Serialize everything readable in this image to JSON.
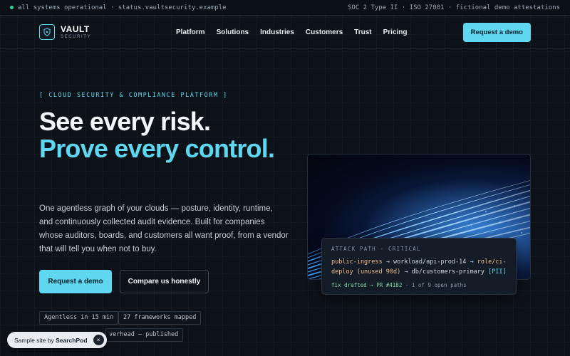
{
  "statusbar": {
    "left": "all systems operational · status.vaultsecurity.example",
    "right": "SOC 2 Type II · ISO 27001 · fictional demo attestations"
  },
  "brand": {
    "name": "VAULT",
    "sub": "SECURITY"
  },
  "nav": {
    "links": [
      "Platform",
      "Solutions",
      "Industries",
      "Customers",
      "Trust",
      "Pricing"
    ],
    "cta": "Request a demo"
  },
  "hero": {
    "eyebrow": "[ CLOUD SECURITY & COMPLIANCE PLATFORM ]",
    "headline_1": "See every risk.",
    "headline_2": "Prove every control.",
    "lede": "One agentless graph of your clouds — posture, identity, runtime, and continuously collected audit evidence. Built for companies whose auditors, boards, and customers all want proof, from a vendor that will tell you when not to buy.",
    "primary_cta": "Request a demo",
    "secondary_cta": "Compare us honestly",
    "chips": [
      "Agentless in 15 min",
      "27 frameworks mapped",
      "verhead — published"
    ]
  },
  "attack_card": {
    "label": "ATTACK PATH · CRITICAL",
    "path_start": "public-ingress",
    "path_mid": " → workload/api-prod-14 → ",
    "path_role": "role/ci-deploy (unused 90d)",
    "path_arrow": " → ",
    "path_db": "db/customers-primary",
    "path_tag": " [PII]",
    "foot_fix": "fix drafted → PR #4182",
    "foot_rest": " · 1 of 9 open paths"
  },
  "toast": {
    "prefix": "Sample site by ",
    "brand": "SearchPod",
    "close": "×"
  },
  "colors": {
    "accent": "#5fd7f0",
    "background": "#0d1219",
    "status_ok": "#34d399"
  }
}
